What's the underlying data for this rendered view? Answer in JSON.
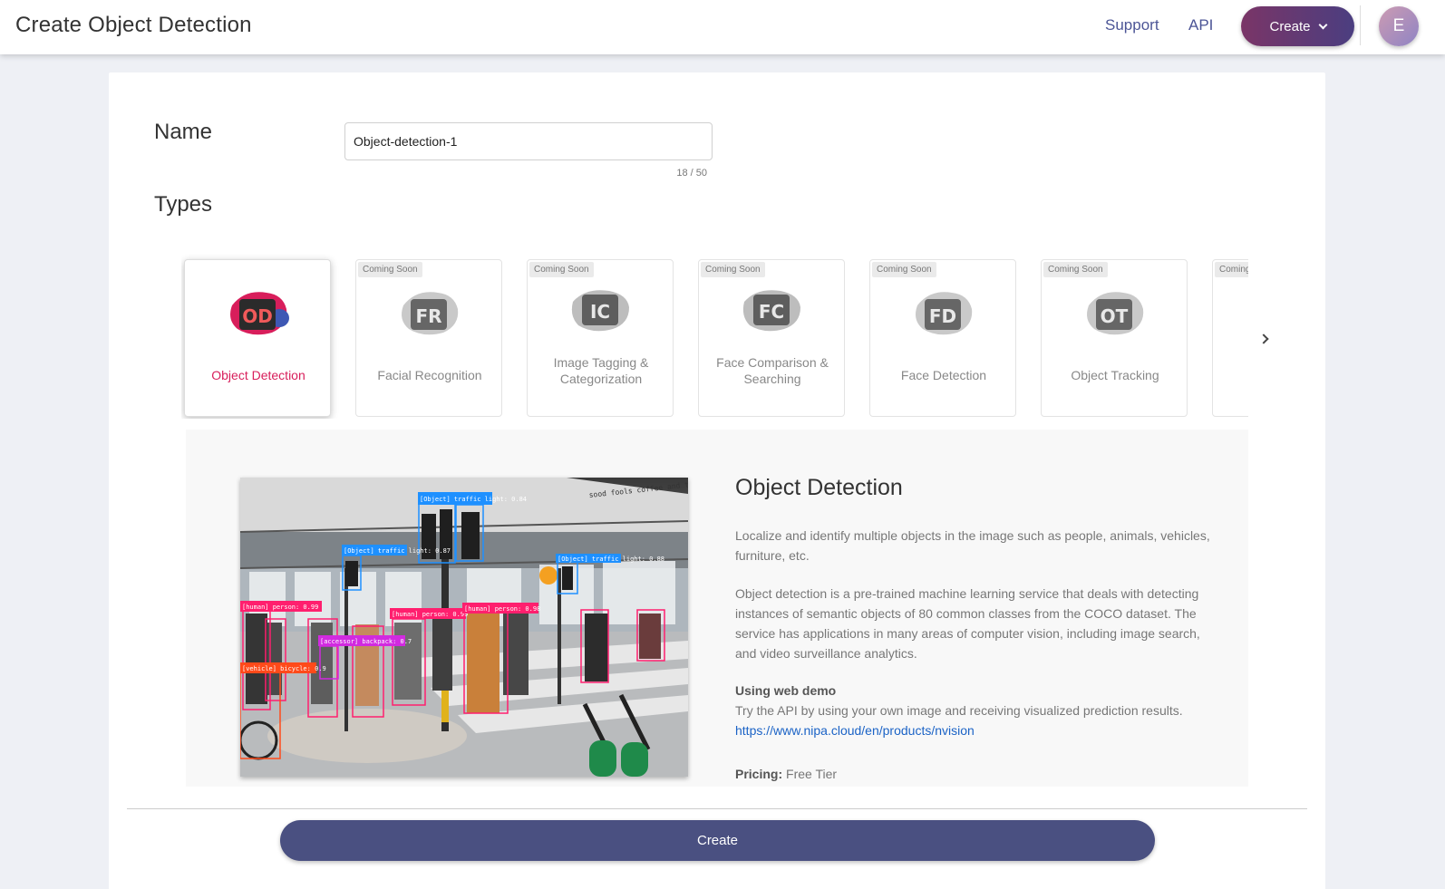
{
  "header": {
    "title": "Create Object Detection",
    "support_label": "Support",
    "api_label": "API",
    "create_label": "Create",
    "avatar_letter": "E"
  },
  "form": {
    "name_label": "Name",
    "name_value": "Object-detection-1",
    "name_counter": "18 / 50",
    "types_label": "Types"
  },
  "types": [
    {
      "abbr": "OD",
      "label": "Object Detection",
      "badge": ""
    },
    {
      "abbr": "FR",
      "label": "Facial Recognition",
      "badge": "Coming Soon"
    },
    {
      "abbr": "IC",
      "label": "Image Tagging & Categorization",
      "badge": "Coming Soon"
    },
    {
      "abbr": "FC",
      "label": "Face Comparison & Searching",
      "badge": "Coming Soon"
    },
    {
      "abbr": "FD",
      "label": "Face Detection",
      "badge": "Coming Soon"
    },
    {
      "abbr": "OT",
      "label": "Object Tracking",
      "badge": "Coming Soon"
    },
    {
      "abbr": "",
      "label": "",
      "badge": "Coming Soon"
    }
  ],
  "detail": {
    "title": "Object Detection",
    "intro": "Localize and identify multiple objects in the image such as people, animals, vehicles, furniture, etc.",
    "description": "Object detection is a pre-trained machine learning service that deals with detecting instances of semantic objects of 80 common classes from the COCO dataset. The service has applications in many areas of computer vision, including image search, and video surveillance analytics.",
    "demo_heading": "Using web demo",
    "demo_text": "Try the API by using your own image and receiving visualized prediction results.",
    "demo_link": "https://www.nipa.cloud/en/products/nvision",
    "pricing_label": "Pricing:",
    "pricing_value": "Free Tier"
  },
  "demo_labels": {
    "shop_sign": "sood fools coffee and treats",
    "traffic_1": "[Object] traffic light: 0.88",
    "traffic_2": "[Object] traffic light: 0.87",
    "traffic_3": "[Object] traffic light: 0.84",
    "human_1": "[human] person: 0.99",
    "human_2": "[human] person: 0.99",
    "human_3": "[human] person: 0.98",
    "backpack": "[accessor] backpack: 0.7",
    "bicycle": "[vehicle] bicycle: 0.9"
  },
  "footer": {
    "create_label": "Create"
  },
  "colors": {
    "accent_pink": "#d81e5b",
    "nav_blue": "#4c5596",
    "create_button": "#4a5081",
    "link": "#1b63c6"
  }
}
